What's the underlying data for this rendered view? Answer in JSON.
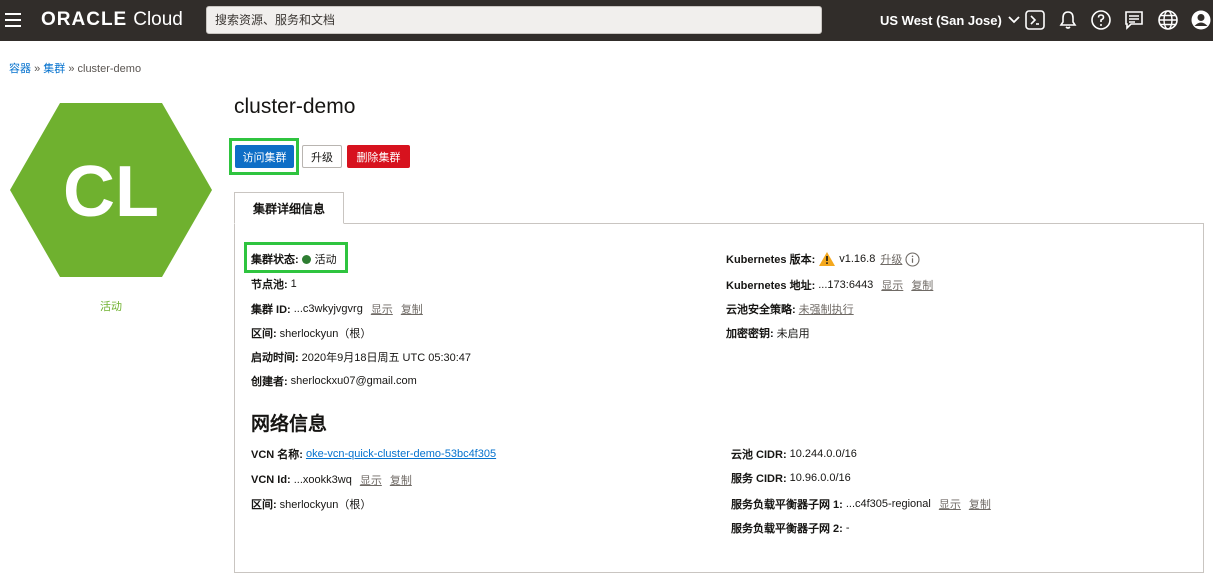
{
  "header": {
    "brand_main": "ORACLE",
    "brand_sub": "Cloud",
    "search_placeholder": "搜索资源、服务和文档",
    "region": "US West (San Jose)",
    "icons": [
      "menu-icon",
      "cloud-shell-icon",
      "bell-icon",
      "help-icon",
      "chat-icon",
      "globe-icon",
      "user-icon"
    ]
  },
  "breadcrumb": {
    "items": [
      "容器",
      "集群",
      "cluster-demo"
    ],
    "separator": "»"
  },
  "hero": {
    "initials": "CL",
    "status": "活动",
    "color": "#6fb12f"
  },
  "page": {
    "title": "cluster-demo",
    "buttons": {
      "access": "访问集群",
      "upgrade": "升级",
      "delete": "删除集群"
    },
    "tab": "集群详细信息"
  },
  "details": {
    "left": {
      "status_label": "集群状态:",
      "status_value": "活动",
      "node_pool_label": "节点池:",
      "node_pool_value": "1",
      "cluster_id_label": "集群 ID:",
      "cluster_id_value": "...c3wkyjvgvrg",
      "compartment_label": "区间:",
      "compartment_value": "sherlockyun（根）",
      "started_label": "启动时间:",
      "started_value": "2020年9月18日周五 UTC 05:30:47",
      "creator_label": "创建者:",
      "creator_value": "sherlockxu07@gmail.com"
    },
    "right": {
      "k8s_version_label": "Kubernetes 版本:",
      "k8s_version_value": "v1.16.8",
      "k8s_upgrade_link": "升级",
      "k8s_address_label": "Kubernetes 地址:",
      "k8s_address_value": "...173:6443",
      "policy_label": "云池安全策略:",
      "policy_value": "未强制执行",
      "encryption_label": "加密密钥:",
      "encryption_value": "未启用"
    },
    "actions": {
      "show": "显示",
      "copy": "复制"
    }
  },
  "network": {
    "title": "网络信息",
    "left": {
      "vcn_name_label": "VCN 名称:",
      "vcn_name_value": "oke-vcn-quick-cluster-demo-53bc4f305",
      "vcn_id_label": "VCN Id:",
      "vcn_id_value": "...xookk3wq",
      "compartment_label": "区间:",
      "compartment_value": "sherlockyun（根）"
    },
    "right": {
      "pod_cidr_label": "云池 CIDR:",
      "pod_cidr_value": "10.244.0.0/16",
      "svc_cidr_label": "服务 CIDR:",
      "svc_cidr_value": "10.96.0.0/16",
      "lb_subnet1_label": "服务负载平衡器子网 1:",
      "lb_subnet1_value": "...c4f305-regional",
      "lb_subnet2_label": "服务负载平衡器子网 2:",
      "lb_subnet2_value": "-"
    }
  },
  "colors": {
    "topbar": "#312d2a",
    "primary": "#0e6ec6",
    "danger": "#d7121e",
    "highlight": "#2fc43f",
    "link": "#0572ce"
  }
}
